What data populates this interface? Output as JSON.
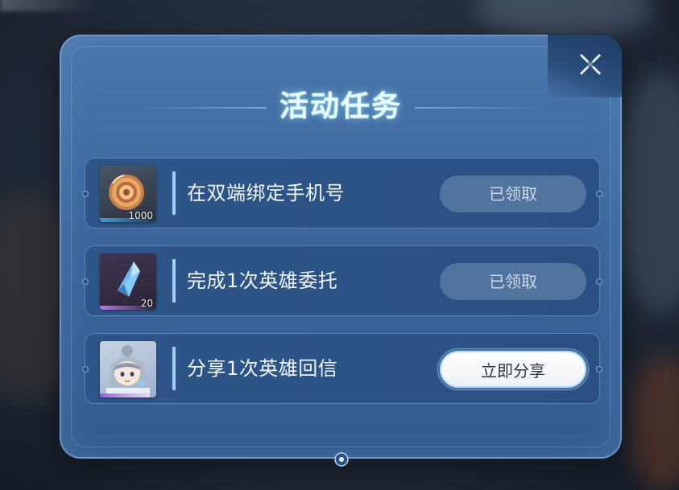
{
  "dialog": {
    "title": "活动任务"
  },
  "tasks": [
    {
      "reward_icon": "bronze-coin-icon",
      "reward_count": "1000",
      "label": "在双端绑定手机号",
      "button": "已领取",
      "state": "claimed"
    },
    {
      "reward_icon": "blue-crystal-icon",
      "reward_count": "20",
      "label": "完成1次英雄委托",
      "button": "已领取",
      "state": "claimed"
    },
    {
      "reward_icon": "hero-portrait-icon",
      "reward_count": "",
      "label": "分享1次英雄回信",
      "button": "立即分享",
      "state": "active"
    }
  ],
  "colors": {
    "dialog_bg": "#3d679c",
    "row_bg": "#2e5588",
    "accent": "#9fd0f5",
    "title_glow": "#96e6ff"
  }
}
